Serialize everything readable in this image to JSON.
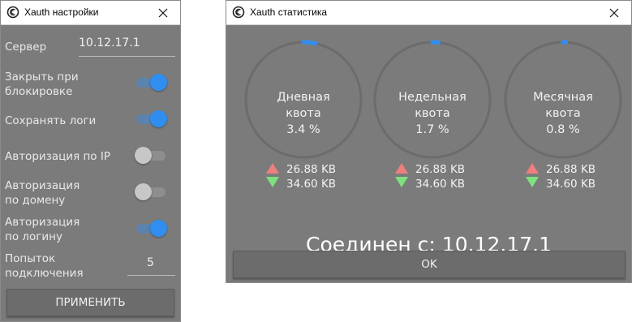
{
  "settings_window": {
    "title": "Xauth настройки",
    "server_label": "Сервер",
    "server_value": "10.12.17.1",
    "options": [
      {
        "label": "Закрыть при блокировке",
        "on": true
      },
      {
        "label": "Сохранять логи",
        "on": true
      },
      {
        "label": "Авторизация по IP",
        "on": false
      },
      {
        "label": "Авторизация по домену",
        "on": false
      },
      {
        "label": "Авторизация по логину",
        "on": true
      }
    ],
    "attempts_label": "Попыток подключения",
    "attempts_value": "5",
    "apply_label": "ПРИМЕНИТЬ"
  },
  "stats_window": {
    "title": "Xauth статистика",
    "gauges": [
      {
        "name_line1": "Дневная",
        "name_line2": "квота",
        "value_text": "3.4 %",
        "percent": 3.4,
        "up": "26.88 KB",
        "down": "34.60 KB"
      },
      {
        "name_line1": "Недельная",
        "name_line2": "квота",
        "value_text": "1.7 %",
        "percent": 1.7,
        "up": "26.88 KB",
        "down": "34.60 KB"
      },
      {
        "name_line1": "Месячная",
        "name_line2": "квота",
        "value_text": "0.8 %",
        "percent": 0.8,
        "up": "26.88 KB",
        "down": "34.60 KB"
      }
    ],
    "connected_text": "Соединен с: 10.12.17.1",
    "ok_label": "OK"
  },
  "colors": {
    "window_bg": "#7b7b7b",
    "accent_blue": "#2f8ef0",
    "upload_red": "#ef7e7e",
    "download_green": "#7ee07e"
  },
  "icons": {
    "app": "xauth-logo-icon",
    "close": "close-icon",
    "upload": "arrow-up-icon",
    "download": "arrow-down-icon"
  }
}
